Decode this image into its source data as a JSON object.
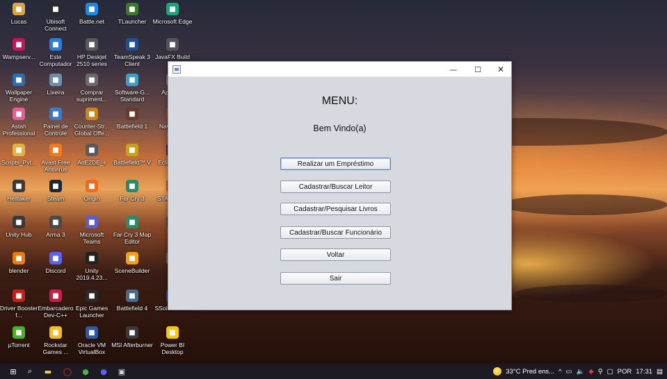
{
  "desktop": {
    "icons": [
      {
        "label": "Lucas",
        "icon": "user-folder-icon",
        "color": "#d9a441"
      },
      {
        "label": "Ubisoft Connect",
        "icon": "ubisoft-icon",
        "color": "#2a2a2a"
      },
      {
        "label": "Battle.net",
        "icon": "battlenet-icon",
        "color": "#1e88e5"
      },
      {
        "label": "TLauncher",
        "icon": "tlauncher-icon",
        "color": "#3b7a2b"
      },
      {
        "label": "Microsoft Edge",
        "icon": "edge-icon",
        "color": "#1fa37a"
      },
      {
        "label": "Wampserv...",
        "icon": "wampserver-icon",
        "color": "#c2185b"
      },
      {
        "label": "Este Computador",
        "icon": "computer-icon",
        "color": "#2a7fd4"
      },
      {
        "label": "HP Deskjet 2510 series",
        "icon": "printer-icon",
        "color": "#5a5a5a"
      },
      {
        "label": "TeamSpeak 3 Client",
        "icon": "teamspeak-icon",
        "color": "#1f4f9a"
      },
      {
        "label": "JavaFX Build",
        "icon": "javafx-icon",
        "color": "#555555"
      },
      {
        "label": "Wallpaper Engine",
        "icon": "wallpaper-engine-icon",
        "color": "#2a6fb0"
      },
      {
        "label": "Lixeira",
        "icon": "recycle-bin-icon",
        "color": "#6a8fb0"
      },
      {
        "label": "Comprar supriment...",
        "icon": "printer-supplies-icon",
        "color": "#6a6a6a"
      },
      {
        "label": "Software-G... Standard",
        "icon": "software-icon",
        "color": "#3aa0c8"
      },
      {
        "label": "Ap NetB",
        "icon": "netbeans-icon",
        "color": "#6a7a8a"
      },
      {
        "label": "Astah Professional",
        "icon": "astah-icon",
        "color": "#e45f9a"
      },
      {
        "label": "Painel de Controle",
        "icon": "control-panel-icon",
        "color": "#3a7ac8"
      },
      {
        "label": "Counter-Str... Global Offe...",
        "icon": "csgo-icon",
        "color": "#c8861a"
      },
      {
        "label": "Battlefield 1",
        "icon": "battlefield-icon",
        "color": "#6a3a2a"
      },
      {
        "label": "Nava Ope",
        "icon": "generic-app-icon",
        "color": "#a04a2a"
      },
      {
        "label": "Scripts_Pyt...",
        "icon": "folder-icon",
        "color": "#e3b341"
      },
      {
        "label": "Avast Free Antivirus",
        "icon": "avast-icon",
        "color": "#f07a1e"
      },
      {
        "label": "AoE2DE_s",
        "icon": "aoe-icon",
        "color": "#5a5a5a"
      },
      {
        "label": "Battlefield™ V",
        "icon": "battlefield-v-icon",
        "color": "#c8a21e"
      },
      {
        "label": "Eclip for Er",
        "icon": "eclipse-icon",
        "color": "#3a2a6a"
      },
      {
        "label": "Helltaker",
        "icon": "helltaker-icon",
        "color": "#3a3a3a"
      },
      {
        "label": "Steam",
        "icon": "steam-icon",
        "color": "#1b2838"
      },
      {
        "label": "Origin",
        "icon": "origin-icon",
        "color": "#f06a1e"
      },
      {
        "label": "Far Cry 3",
        "icon": "farcry-icon",
        "color": "#2a8a6a"
      },
      {
        "label": "STAR Squa",
        "icon": "generic-app-icon",
        "color": "#c84a1e"
      },
      {
        "label": "Unity Hub",
        "icon": "unity-hub-icon",
        "color": "#3a3a3a"
      },
      {
        "label": "Arma 3",
        "icon": "arma-icon",
        "color": "#4a4a4a"
      },
      {
        "label": "Microsoft Teams",
        "icon": "teams-icon",
        "color": "#5b5fc7"
      },
      {
        "label": "Far Cry 3 Map Editor",
        "icon": "farcry-editor-icon",
        "color": "#2a8a6a"
      },
      {
        "label": "DE",
        "icon": "generic-app-icon",
        "color": "#4a4a4a"
      },
      {
        "label": "blender",
        "icon": "blender-icon",
        "color": "#e87d0d"
      },
      {
        "label": "Discord",
        "icon": "discord-icon",
        "color": "#5865f2"
      },
      {
        "label": "Unity 2019.4.23...",
        "icon": "unity-icon",
        "color": "#222222"
      },
      {
        "label": "SceneBuilder",
        "icon": "scenebuilder-icon",
        "color": "#f0a01e"
      },
      {
        "label": "Ro",
        "icon": "generic-app-icon",
        "color": "#6a6a6a"
      },
      {
        "label": "Driver Booster f...",
        "icon": "driver-booster-icon",
        "color": "#c81e1e"
      },
      {
        "label": "Embarcadero Dev-C++",
        "icon": "devcpp-icon",
        "color": "#c81e4a"
      },
      {
        "label": "Epic Games Launcher",
        "icon": "epic-games-icon",
        "color": "#2a2a2a"
      },
      {
        "label": "Battlefield 4",
        "icon": "battlefield4-icon",
        "color": "#4a6a8a"
      },
      {
        "label": "SSolver 5.4.1",
        "icon": "ssolver-icon",
        "color": "#1e4ac8"
      },
      {
        "label": "µTorrent",
        "icon": "utorrent-icon",
        "color": "#4ab02a"
      },
      {
        "label": "Rockstar Games ...",
        "icon": "rockstar-icon",
        "color": "#f0c01e"
      },
      {
        "label": "Oracle VM VirtualBox",
        "icon": "virtualbox-icon",
        "color": "#2a5aa0"
      },
      {
        "label": "MSI Afterburner",
        "icon": "msi-afterburner-icon",
        "color": "#3a3a3a"
      },
      {
        "label": "Power BI Desktop",
        "icon": "power-bi-icon",
        "color": "#f2c811"
      }
    ]
  },
  "window": {
    "menu_title": "MENU:",
    "welcome": "Bem Vindo(a)",
    "minimize_symbol": "—",
    "maximize_symbol": "☐",
    "close_symbol": "✕",
    "buttons": {
      "emprestimo": "Realizar um Empréstimo",
      "leitor": "Cadastrar/Buscar Leitor",
      "livros": "Cadastrar/Pesquisar Livros",
      "funcionario": "Cadastrar/Buscar Funcionário",
      "voltar": "Voltar",
      "sair": "Sair"
    }
  },
  "taskbar": {
    "weather": "33°C  Pred ens...",
    "language": "POR",
    "time": "17:31"
  }
}
